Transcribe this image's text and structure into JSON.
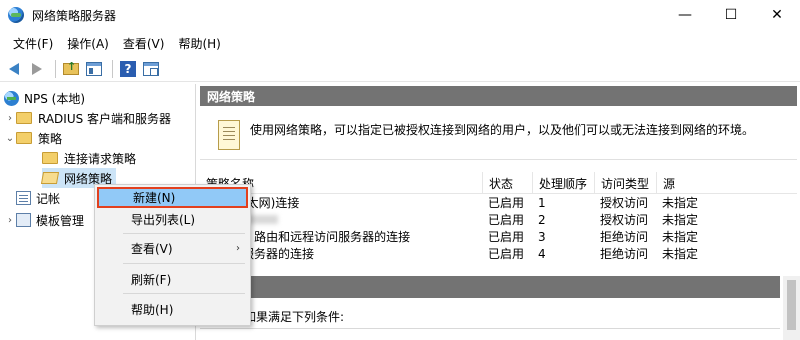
{
  "window": {
    "title": "网络策略服务器",
    "min": "—",
    "max": "☐",
    "close": "✕"
  },
  "menu": [
    "文件(F)",
    "操作(A)",
    "查看(V)",
    "帮助(H)"
  ],
  "toolbar": {
    "icons": [
      "back-arrow-icon",
      "forward-arrow-icon",
      "folder-up-icon",
      "tree-view-icon",
      "help-icon",
      "properties-icon"
    ]
  },
  "tree": {
    "root": "NPS (本地)",
    "radius": "RADIUS 客户端和服务器",
    "policies": "策略",
    "conn_policy": "连接请求策略",
    "net_policy": "网络策略",
    "accounting": "记帐",
    "templates": "模板管理"
  },
  "right": {
    "header": "网络策略",
    "description": "使用网络策略，可以指定已被授权连接到网络的用户，以及他们可以或无法连接到网络的环境。",
    "columns": [
      "策略名称",
      "状态",
      "处理顺序",
      "访问类型",
      "源"
    ],
    "rows": [
      {
        "name": "有线(以太网)连接",
        "status": "已启用",
        "order": "1",
        "access": "授权访问",
        "source": "未指定"
      },
      {
        "name": "",
        "status": "已启用",
        "order": "2",
        "access": "授权访问",
        "source": "未指定"
      },
      {
        "name": "icrosoft 路由和远程访问服务器的连接",
        "status": "已启用",
        "order": "3",
        "access": "拒绝访问",
        "source": "未指定"
      },
      {
        "name": "他访问服务器的连接",
        "status": "已启用",
        "order": "4",
        "access": "拒绝访问",
        "source": "未指定"
      }
    ],
    "condition": "如果满足下列条件:"
  },
  "context_menu": {
    "new": "新建(N)",
    "export": "导出列表(L)",
    "view": "查看(V)",
    "refresh": "刷新(F)",
    "help": "帮助(H)",
    "submenu_arrow": "›"
  },
  "colors": {
    "highlight": "#91c9f7",
    "highlight_border": "#e2401e",
    "header_band": "#737373"
  }
}
